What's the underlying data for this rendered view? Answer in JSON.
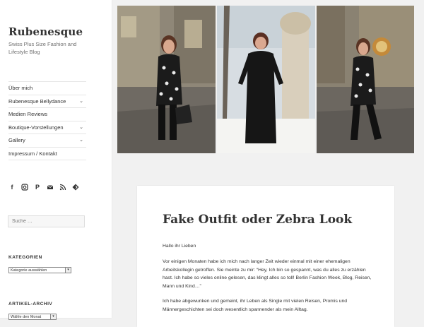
{
  "site": {
    "title": "Rubenesque",
    "description": "Swiss Plus Size Fashion and Lifestyle Blog"
  },
  "menu": [
    {
      "label": "Über mich",
      "has_children": false
    },
    {
      "label": "Rubenesque Bellydance",
      "has_children": true
    },
    {
      "label": "Medien Reviews",
      "has_children": false
    },
    {
      "label": "Boutique-Vorstellungen",
      "has_children": true
    },
    {
      "label": "Gallery",
      "has_children": true
    },
    {
      "label": "Impressum / Kontakt",
      "has_children": false
    }
  ],
  "social_icons": [
    "facebook-icon",
    "instagram-icon",
    "pinterest-icon",
    "email-icon",
    "rss-icon",
    "feedly-icon"
  ],
  "search": {
    "placeholder": "Suche …"
  },
  "widgets": {
    "categories": {
      "title": "KATEGORIEN",
      "select_value": "Kategorie auswählen"
    },
    "archive": {
      "title": "ARTIKEL-ARCHIV",
      "select_value": "Wähle den Monat"
    }
  },
  "post": {
    "title": "Fake Outfit oder Zebra Look",
    "greeting": "Hallo ihr Lieben",
    "paragraph1": "Vor einigen Monaten habe ich mich nach langer Zeit wieder einmal mit einer ehemaligen Arbeitskollegin getroffen. Sie meinte zu mir: “Hey, Ich bin so gespannt, was du alles zu erzählen hast. Ich habe so vieles online gelesen, das klingt alles so toll! Berlin Fashion Week, Blog, Reisen, Mann und Kind…”",
    "paragraph2": "Ich habe abgewunken und gemeint, ihr Leben als Single mit vielen Reisen, Promis und Männergeschichten sei doch wesentlich spannender als mein Alltag."
  },
  "colors": {
    "background": "#f1f1f1",
    "panel": "#ffffff",
    "text": "#333333"
  }
}
